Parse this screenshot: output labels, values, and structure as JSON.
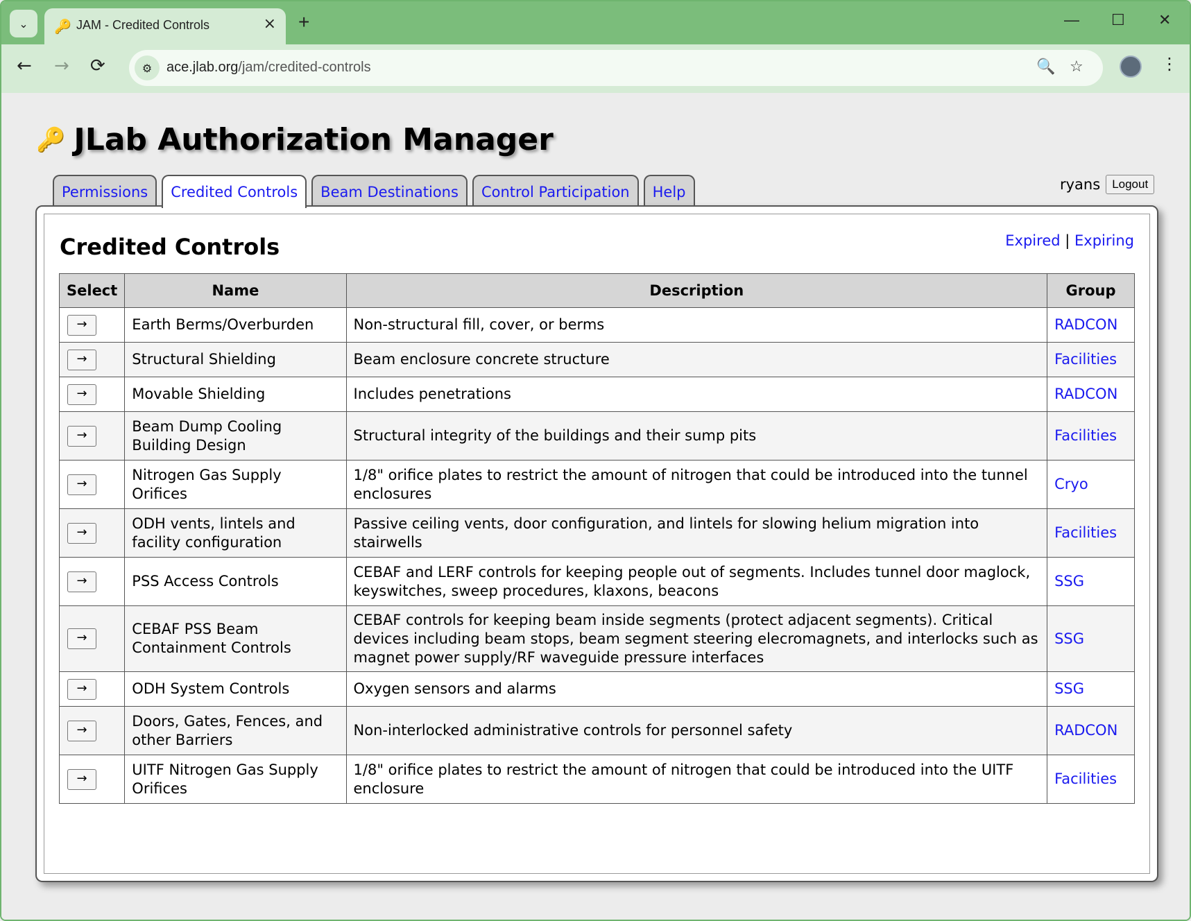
{
  "browser": {
    "tab_title": "JAM - Credited Controls",
    "tab_close": "×",
    "new_tab": "+",
    "window_controls": [
      "—",
      "☐",
      "✕"
    ],
    "url_host": "ace.jlab.org",
    "url_path": "/jam/credited-controls",
    "nav_back": "←",
    "nav_forward": "→",
    "nav_reload": "⟳",
    "tab_search": "⌄",
    "site_info": "⚙",
    "zoom_icon": "🔍",
    "star_icon": "☆",
    "menu_icon": "⋮"
  },
  "app": {
    "title": "JLab Authorization Manager",
    "logo_icon": "🔑",
    "tabs": [
      {
        "label": "Permissions",
        "active": false
      },
      {
        "label": "Credited Controls",
        "active": true
      },
      {
        "label": "Beam Destinations",
        "active": false
      },
      {
        "label": "Control Participation",
        "active": false
      },
      {
        "label": "Help",
        "active": false
      }
    ],
    "username": "ryans",
    "logout_label": "Logout"
  },
  "main": {
    "heading": "Credited Controls",
    "links": {
      "expired": "Expired",
      "separator": "|",
      "expiring": "Expiring"
    },
    "table": {
      "headers": [
        "Select",
        "Name",
        "Description",
        "Group"
      ],
      "select_glyph": "→",
      "rows": [
        {
          "name": "Earth Berms/Overburden",
          "description": "Non-structural fill, cover, or berms",
          "group": "RADCON"
        },
        {
          "name": "Structural Shielding",
          "description": "Beam enclosure concrete structure",
          "group": "Facilities"
        },
        {
          "name": "Movable Shielding",
          "description": "Includes penetrations",
          "group": "RADCON"
        },
        {
          "name": "Beam Dump Cooling Building Design",
          "description": "Structural integrity of the buildings and their sump pits",
          "group": "Facilities"
        },
        {
          "name": "Nitrogen Gas Supply Orifices",
          "description": "1/8\" orifice plates to restrict the amount of nitrogen that could be introduced into the tunnel enclosures",
          "group": "Cryo"
        },
        {
          "name": "ODH vents, lintels and facility configuration",
          "description": "Passive ceiling vents, door configuration, and lintels for slowing helium migration into stairwells",
          "group": "Facilities"
        },
        {
          "name": "PSS Access Controls",
          "description": "CEBAF and LERF controls for keeping people out of segments. Includes tunnel door maglock, keyswitches, sweep procedures, klaxons, beacons",
          "group": "SSG"
        },
        {
          "name": "CEBAF PSS Beam Containment Controls",
          "description": "CEBAF controls for keeping beam inside segments (protect adjacent segments). Critical devices including beam stops, beam segment steering elecromagnets, and interlocks such as magnet power supply/RF waveguide pressure interfaces",
          "group": "SSG"
        },
        {
          "name": "ODH System Controls",
          "description": "Oxygen sensors and alarms",
          "group": "SSG"
        },
        {
          "name": "Doors, Gates, Fences, and other Barriers",
          "description": "Non-interlocked administrative controls for personnel safety",
          "group": "RADCON"
        },
        {
          "name": "UITF Nitrogen Gas Supply Orifices",
          "description": "1/8\" orifice plates to restrict the amount of nitrogen that could be introduced into the UITF enclosure",
          "group": "Facilities"
        }
      ]
    }
  }
}
